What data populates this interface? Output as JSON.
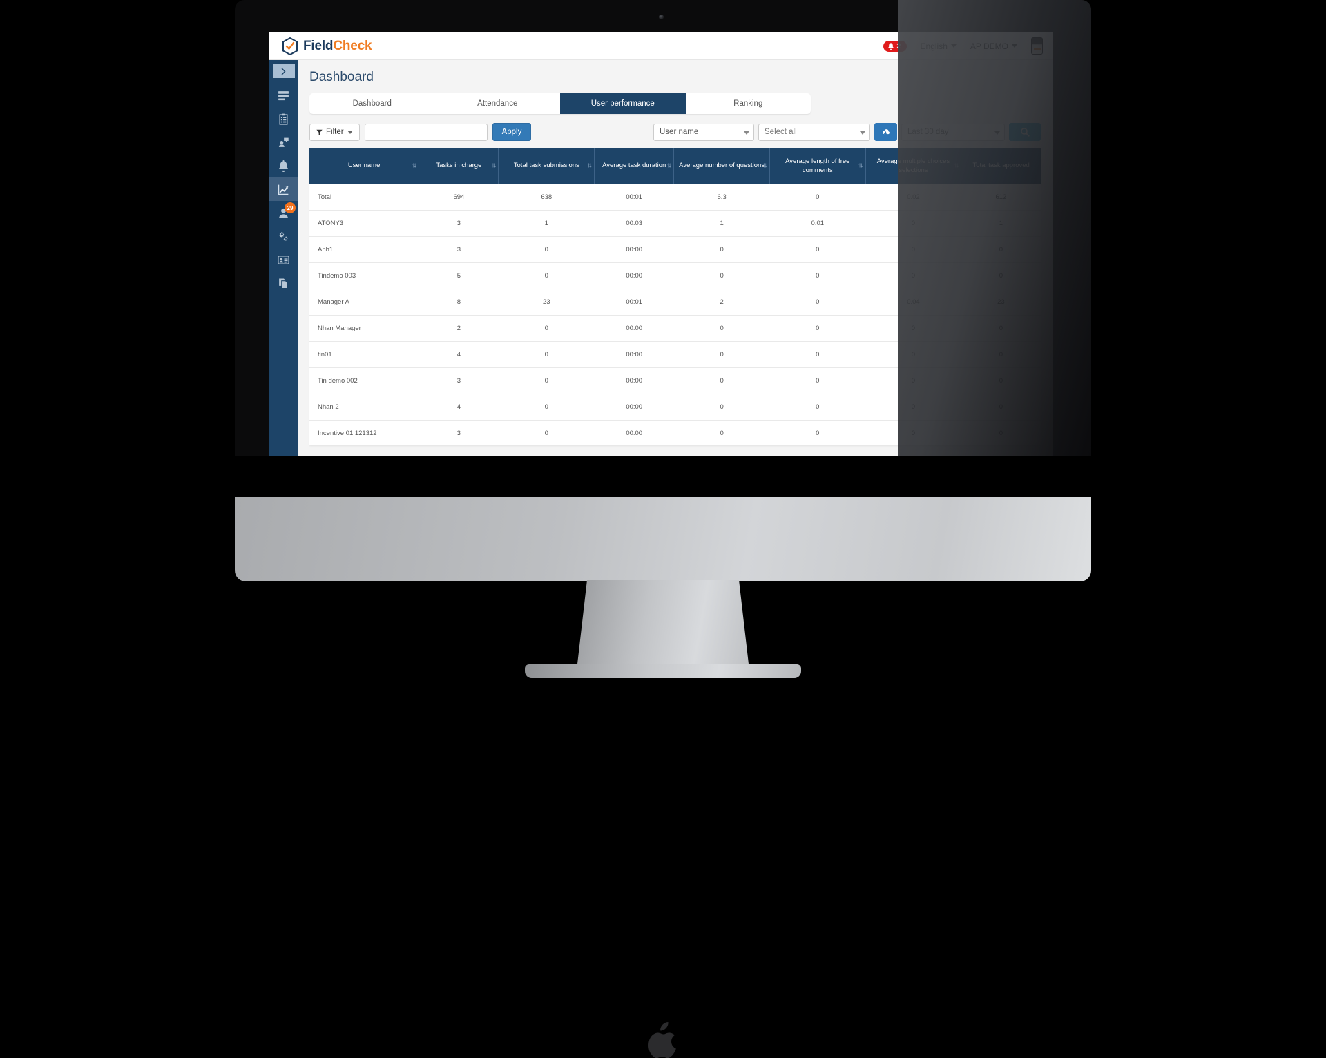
{
  "app": {
    "brand_first": "Field",
    "brand_second": "Check",
    "logo_icon": "shield-check-icon"
  },
  "header": {
    "notification_count": "2",
    "notification_icon": "bell-icon",
    "language": "English",
    "account": "AP DEMO",
    "avatar_icon": "user-avatar"
  },
  "sidebar": {
    "toggle_icon": "chevron-right-icon",
    "items": [
      {
        "name": "sidebar-item-list",
        "icon": "list-icon",
        "active": false,
        "badge": ""
      },
      {
        "name": "sidebar-item-tasks",
        "icon": "clipboard-icon",
        "active": false,
        "badge": ""
      },
      {
        "name": "sidebar-item-support",
        "icon": "chat-user-icon",
        "active": false,
        "badge": ""
      },
      {
        "name": "sidebar-item-notifications",
        "icon": "bell-icon",
        "active": false,
        "badge": ""
      },
      {
        "name": "sidebar-item-reports",
        "icon": "chart-line-icon",
        "active": true,
        "badge": ""
      },
      {
        "name": "sidebar-item-users",
        "icon": "user-icon",
        "active": false,
        "badge": "29"
      },
      {
        "name": "sidebar-item-settings",
        "icon": "gears-icon",
        "active": false,
        "badge": ""
      },
      {
        "name": "sidebar-item-contacts",
        "icon": "id-card-icon",
        "active": false,
        "badge": ""
      },
      {
        "name": "sidebar-item-documents",
        "icon": "documents-icon",
        "active": false,
        "badge": ""
      }
    ]
  },
  "page": {
    "title": "Dashboard"
  },
  "tabs": [
    {
      "label": "Dashboard",
      "active": false
    },
    {
      "label": "Attendance",
      "active": false
    },
    {
      "label": "User performance",
      "active": true
    },
    {
      "label": "Ranking",
      "active": false
    }
  ],
  "filters": {
    "filter_button": "Filter",
    "filter_icon": "funnel-icon",
    "search_text_value": "",
    "search_text_placeholder": "",
    "apply_button": "Apply",
    "field_select": "User name",
    "value_select": "Select all",
    "export_icon": "cloud-download-icon",
    "date_range": "Last 30 day",
    "search_icon": "magnifier-icon"
  },
  "table": {
    "columns": [
      "User name",
      "Tasks in charge",
      "Total task submissions",
      "Average task duration",
      "Average number of questions",
      "Average length of free comments",
      "Average multiple choices selections",
      "Total task approved"
    ],
    "rows": [
      [
        "Total",
        "694",
        "638",
        "00:01",
        "6.3",
        "0",
        "0.02",
        "612"
      ],
      [
        "ATONY3",
        "3",
        "1",
        "00:03",
        "1",
        "0.01",
        "0",
        "1"
      ],
      [
        "Anh1",
        "3",
        "0",
        "00:00",
        "0",
        "0",
        "0",
        "0"
      ],
      [
        "Tindemo 003",
        "5",
        "0",
        "00:00",
        "0",
        "0",
        "0",
        "0"
      ],
      [
        "Manager A",
        "8",
        "23",
        "00:01",
        "2",
        "0",
        "0.04",
        "23"
      ],
      [
        "Nhan Manager",
        "2",
        "0",
        "00:00",
        "0",
        "0",
        "0",
        "0"
      ],
      [
        "tin01",
        "4",
        "0",
        "00:00",
        "0",
        "0",
        "0",
        "0"
      ],
      [
        "Tin demo 002",
        "3",
        "0",
        "00:00",
        "0",
        "0",
        "0",
        "0"
      ],
      [
        "Nhan 2",
        "4",
        "0",
        "00:00",
        "0",
        "0",
        "0",
        "0"
      ],
      [
        "Incentive 01 121312",
        "3",
        "0",
        "00:00",
        "0",
        "0",
        "0",
        "0"
      ]
    ]
  },
  "colors": {
    "brand_navy": "#1d4468",
    "brand_orange": "#f07c22",
    "apply_blue": "#337ab7",
    "search_blue": "#45b4dd",
    "export_blue": "#2e77b8",
    "badge_red": "#e01b1b",
    "badge_orange": "#f2711c"
  }
}
